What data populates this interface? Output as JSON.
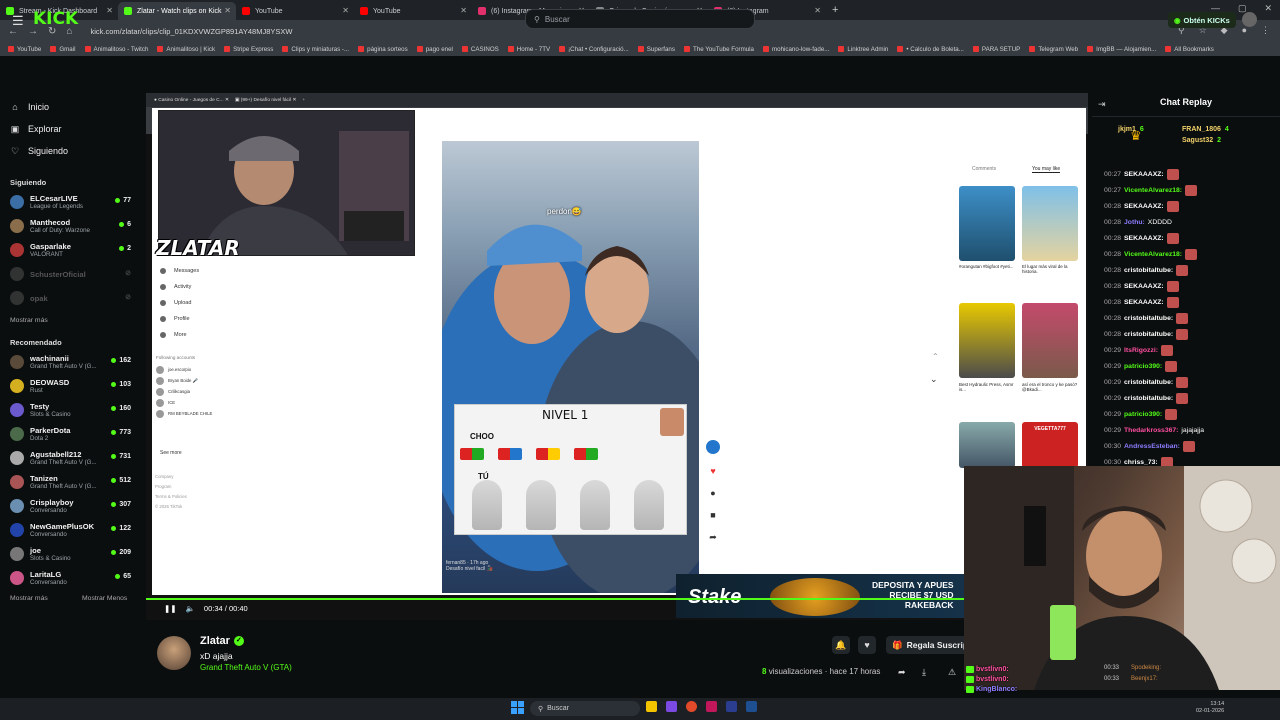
{
  "tabs": [
    {
      "label": "Stream - Kick Dashboard",
      "color": "#53fc18",
      "active": false
    },
    {
      "label": "Zlatar - Watch clips on Kick",
      "color": "#53fc18",
      "active": true
    },
    {
      "label": "YouTube",
      "color": "#ff0000",
      "active": false
    },
    {
      "label": "YouTube",
      "color": "#ff0000",
      "active": false
    },
    {
      "label": "(6) Instagram • Mensajes",
      "color": "#e1306c",
      "active": false
    },
    {
      "label": "Origen de Copiapó",
      "color": "#888888",
      "active": false
    },
    {
      "label": "(6) Instagram",
      "color": "#e1306c",
      "active": false
    }
  ],
  "url": "kick.com/zlatar/clips/clip_01KDXVWZGP891AY48MJ8YSXW",
  "bookmarks": [
    "YouTube",
    "Gmail",
    "Animalitoso - Twitch",
    "Animalitoso | Kick",
    "Stripe Express",
    "Clips y miniaturas -...",
    "página sorteos",
    "pago enel",
    "CASINOS",
    "Home - 7TV",
    "¡Chat • Configuració...",
    "Superfans",
    "The YouTube Formula",
    "mohicano-low-fade...",
    "Linktree Admin",
    "• Calculo de Boleta...",
    "PARA SETUP",
    "Telegram Web",
    "ImgBB — Alojamien...",
    "All Bookmarks"
  ],
  "header": {
    "logo": "KICK",
    "search_placeholder": "Buscar",
    "obtain_label": "Obtén KICKs"
  },
  "nav": [
    {
      "label": "Inicio",
      "icon": "home-icon",
      "glyph": "⌂"
    },
    {
      "label": "Explorar",
      "icon": "compass-icon",
      "glyph": "▣"
    },
    {
      "label": "Siguiendo",
      "icon": "heart-icon",
      "glyph": "♡"
    }
  ],
  "following": {
    "title": "Siguiendo",
    "channels": [
      {
        "name": "ELCesarLIVE",
        "game": "League of Legends",
        "viewers": "77",
        "color": "#3b6ea5",
        "online": true
      },
      {
        "name": "Manthecod",
        "game": "Call of Duty: Warzone",
        "viewers": "6",
        "color": "#8a6d4b",
        "online": true
      },
      {
        "name": "Gasparlake",
        "game": "VALORANT",
        "viewers": "2",
        "color": "#a33",
        "online": true
      },
      {
        "name": "SchusterOficial",
        "game": "",
        "viewers": "",
        "color": "#777",
        "online": false
      },
      {
        "name": "opak",
        "game": "",
        "viewers": "",
        "color": "#777",
        "online": false
      }
    ],
    "more": "Mostrar más"
  },
  "recommended": {
    "title": "Recomendado",
    "channels": [
      {
        "name": "wachinanii",
        "game": "Grand Theft Auto V (G...",
        "viewers": "162",
        "color": "#5a4a3a"
      },
      {
        "name": "DEOWASD",
        "game": "Rust",
        "viewers": "103",
        "color": "#d4b020"
      },
      {
        "name": "Testy",
        "game": "Slots & Casino",
        "viewers": "160",
        "color": "#6a5acd"
      },
      {
        "name": "ParkerDota",
        "game": "Dota 2",
        "viewers": "773",
        "color": "#4a6a4a"
      },
      {
        "name": "Agustabell212",
        "game": "Grand Theft Auto V (G...",
        "viewers": "731",
        "color": "#aaa"
      },
      {
        "name": "Tanizen",
        "game": "Grand Theft Auto V (G...",
        "viewers": "512",
        "color": "#a55"
      },
      {
        "name": "Crisplayboy",
        "game": "Conversando",
        "viewers": "307",
        "color": "#6a8fb0"
      },
      {
        "name": "NewGamePlusOK",
        "game": "Conversando",
        "viewers": "122",
        "color": "#2244aa"
      },
      {
        "name": "joe",
        "game": "Slots & Casino",
        "viewers": "209",
        "color": "#777"
      },
      {
        "name": "LaritaLG",
        "game": "Conversando",
        "viewers": "65",
        "color": "#c58"
      }
    ],
    "more": "Mostrar más",
    "less": "Mostrar Menos"
  },
  "overlay_name": "ZLATAR",
  "inner_menu": [
    "Messages",
    "Activity",
    "Upload",
    "Profile",
    "More"
  ],
  "inner_following_title": "Following accounts",
  "inner_accounts": [
    "joe.escorpio",
    "Bryan Boide 🎤",
    "Crilikcasgia",
    "ICE",
    "RM BEYBLADE CHILE"
  ],
  "inner_see_more": "See more",
  "inner_footer": [
    "Company",
    "Program",
    "Terms & Policies",
    "© 2026 TikTok"
  ],
  "video_caption": "perdon😅",
  "game_title": "NIVEL 1",
  "game_choo": "CHOO",
  "game_tu": "TÚ",
  "side_tabs": [
    "Comments",
    "You may like"
  ],
  "side_captions": [
    "#orangutan #bigfoot #yeti...",
    "El lugar más viral de la historia.",
    "Best Hydraulic Press, Asmr is...",
    "así era el tronco y ke pasó? @Bkadi..."
  ],
  "side_thumb_label": "VEGETTA777",
  "video_user": "fernan85 · 17h ago",
  "video_desc": "Desafío nivel facil 🚂",
  "pause_tooltip": "Pausa (espacio)",
  "time": "00:34 / 00:40",
  "progress": 1.0,
  "ad": {
    "brand": "Stake",
    "line1": "DEPOSITA Y APUES",
    "line2": "RECIBE $7 USD",
    "line3": "RAKEBACK"
  },
  "streamer": {
    "name": "Zlatar",
    "title": "xD ajajja",
    "game": "Grand Theft Auto V (GTA)",
    "views_count": "8",
    "views_label": "visualizaciones",
    "ago": "· hace 17 horas",
    "gift_label": "Regala Suscrip"
  },
  "chat": {
    "title": "Chat Replay",
    "leaders": [
      {
        "name": "jkjm1",
        "value": "6",
        "color": "#53fc18"
      },
      {
        "name": "FRAN_1806",
        "value": "4",
        "color": "#53fc18"
      },
      {
        "name": "Sagust32",
        "value": "2",
        "color": "#53fc18"
      }
    ],
    "messages": [
      {
        "t": "00:27",
        "u": "SEKAAAXZ:",
        "c": "#ffffff",
        "m": ""
      },
      {
        "t": "00:27",
        "u": "VicenteAlvarez18:",
        "c": "#53fc18",
        "m": ""
      },
      {
        "t": "00:28",
        "u": "SEKAAAXZ:",
        "c": "#ffffff",
        "m": ""
      },
      {
        "t": "00:28",
        "u": "Jothu:",
        "c": "#8c7dff",
        "m": "XDDDD"
      },
      {
        "t": "00:28",
        "u": "SEKAAAXZ:",
        "c": "#ffffff",
        "m": ""
      },
      {
        "t": "00:28",
        "u": "VicenteAlvarez18:",
        "c": "#53fc18",
        "m": ""
      },
      {
        "t": "00:28",
        "u": "cristobitaltube:",
        "c": "#ffffff",
        "m": ""
      },
      {
        "t": "00:28",
        "u": "SEKAAAXZ:",
        "c": "#ffffff",
        "m": ""
      },
      {
        "t": "00:28",
        "u": "SEKAAAXZ:",
        "c": "#ffffff",
        "m": ""
      },
      {
        "t": "00:28",
        "u": "cristobitaltube:",
        "c": "#ffffff",
        "m": ""
      },
      {
        "t": "00:28",
        "u": "cristobitaltube:",
        "c": "#ffffff",
        "m": ""
      },
      {
        "t": "00:29",
        "u": "ItsRigozzi:",
        "c": "#ff4fa0",
        "m": ""
      },
      {
        "t": "00:29",
        "u": "patricio390:",
        "c": "#53fc18",
        "m": ""
      },
      {
        "t": "00:29",
        "u": "cristobitaltube:",
        "c": "#ffffff",
        "m": ""
      },
      {
        "t": "00:29",
        "u": "cristobitaltube:",
        "c": "#ffffff",
        "m": ""
      },
      {
        "t": "00:29",
        "u": "patricio390:",
        "c": "#53fc18",
        "m": ""
      },
      {
        "t": "00:29",
        "u": "Thedarkross367:",
        "c": "#ff4fa0",
        "m": "jajajajja"
      },
      {
        "t": "00:30",
        "u": "AndressEsteban:",
        "c": "#8c7dff",
        "m": ""
      },
      {
        "t": "00:30",
        "u": "chriss_73:",
        "c": "#ffffff",
        "m": ""
      }
    ],
    "cam_chat": [
      {
        "u": "bvstlivn0:",
        "c": "#ff4fa0"
      },
      {
        "u": "bvstlivn0:",
        "c": "#ff4fa0"
      },
      {
        "u": "KingBlanco:",
        "c": "#8c7dff"
      }
    ],
    "cam_side": [
      {
        "t": "00:33",
        "u": "Spodeking:"
      },
      {
        "t": "00:33",
        "u": "Beenjx17:"
      }
    ]
  },
  "taskbar": {
    "search": "Buscar",
    "clock": "13:14",
    "date": "02-01-2026"
  }
}
